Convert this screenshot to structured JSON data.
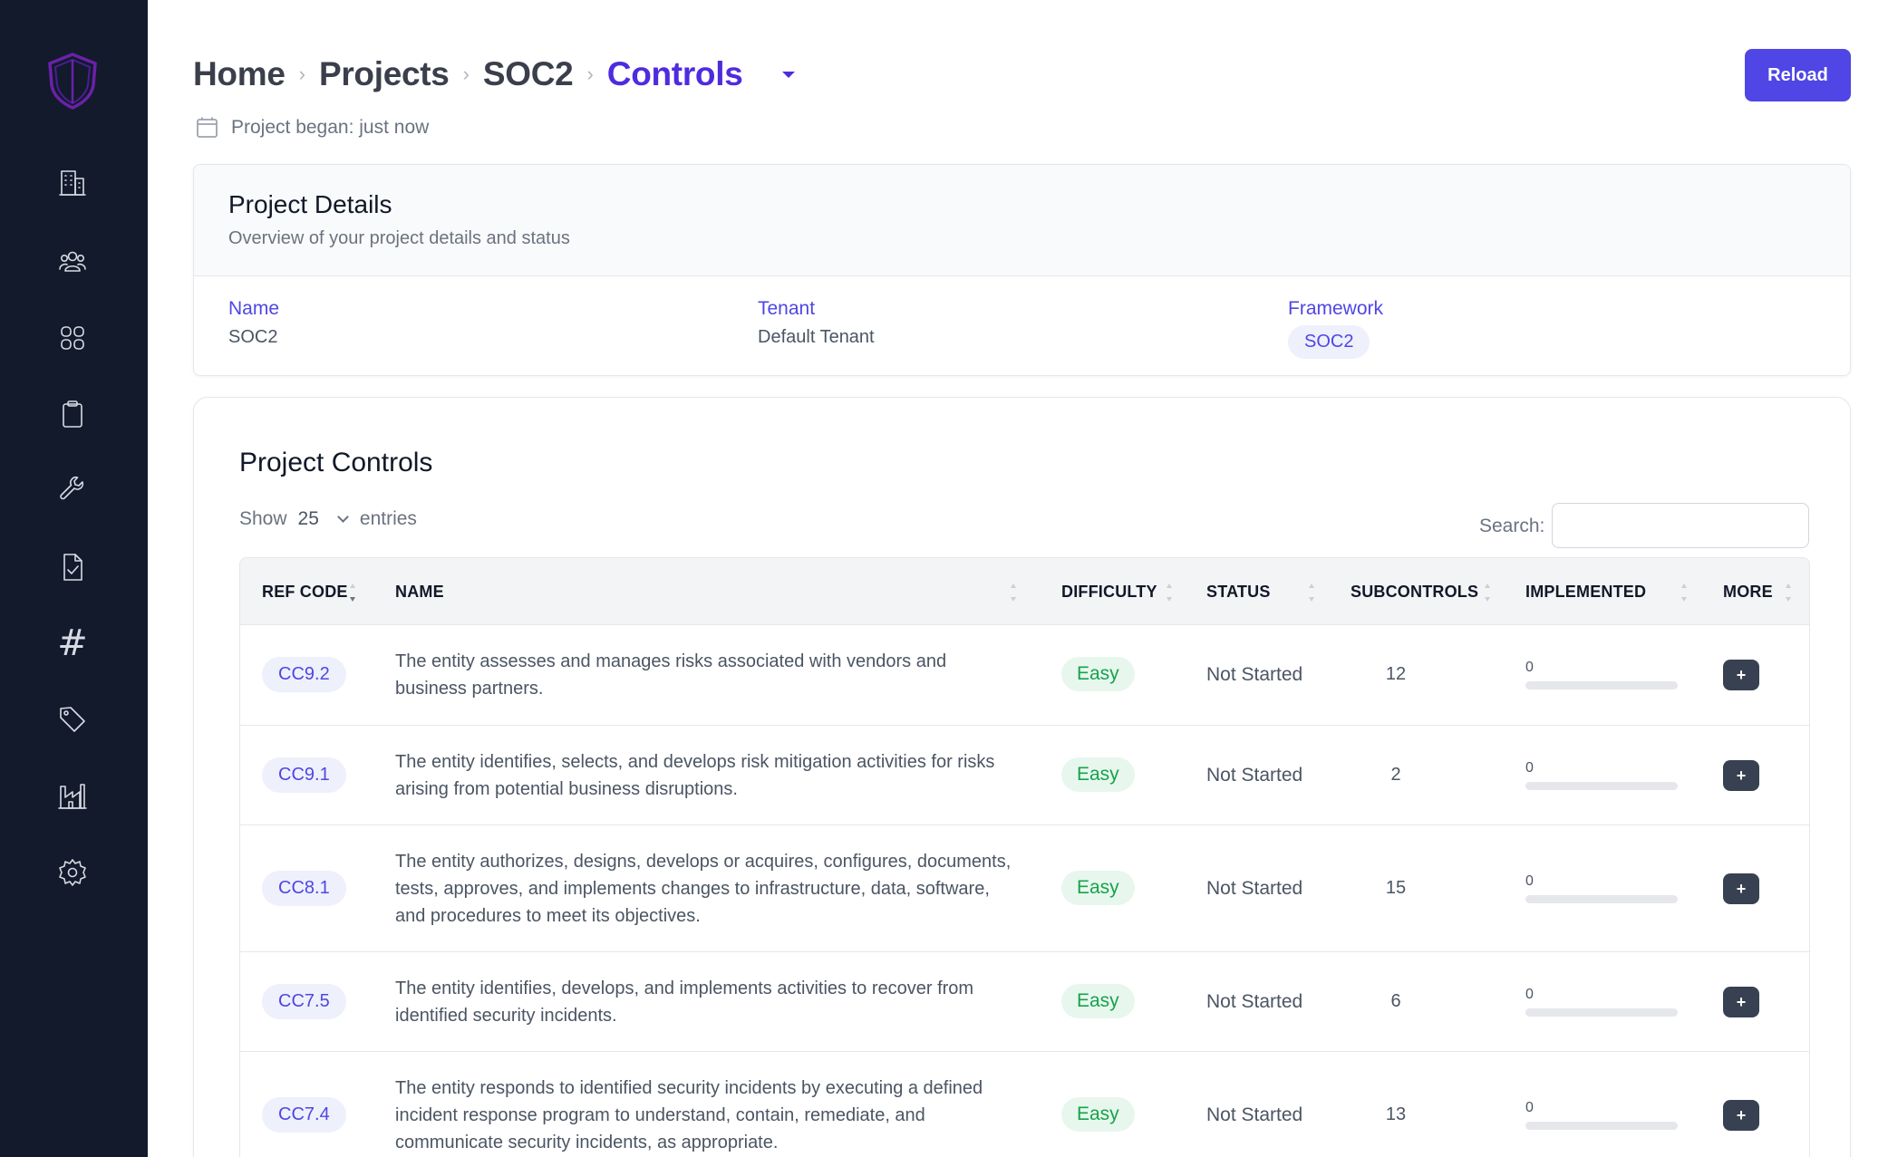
{
  "breadcrumb": {
    "items": [
      "Home",
      "Projects",
      "SOC2"
    ],
    "current": "Controls"
  },
  "began": "Project began: just now",
  "reload_label": "Reload",
  "details": {
    "title": "Project Details",
    "subtitle": "Overview of your project details and status",
    "name_label": "Name",
    "name_value": "SOC2",
    "tenant_label": "Tenant",
    "tenant_value": "Default Tenant",
    "framework_label": "Framework",
    "framework_value": "SOC2"
  },
  "controls": {
    "title": "Project Controls",
    "show_label": "Show",
    "page_size": "25",
    "entries_label": "entries",
    "search_label": "Search:",
    "search_value": "",
    "columns": {
      "ref": "REF CODE",
      "name": "NAME",
      "difficulty": "DIFFICULTY",
      "status": "STATUS",
      "subcontrols": "SUBCONTROLS",
      "implemented": "IMPLEMENTED",
      "more": "MORE"
    },
    "more_label": "+",
    "rows": [
      {
        "ref": "CC9.2",
        "name": "The entity assesses and manages risks associated with vendors and business partners.",
        "difficulty": "Easy",
        "status": "Not Started",
        "subcontrols": "12",
        "implemented": "0",
        "implemented_fraction": 0
      },
      {
        "ref": "CC9.1",
        "name": "The entity identifies, selects, and develops risk mitigation activities for risks arising from potential business disruptions.",
        "difficulty": "Easy",
        "status": "Not Started",
        "subcontrols": "2",
        "implemented": "0",
        "implemented_fraction": 0
      },
      {
        "ref": "CC8.1",
        "name": "The entity authorizes, designs, develops or acquires, configures, documents, tests, approves, and implements changes to infrastructure, data, software, and procedures to meet its objectives.",
        "difficulty": "Easy",
        "status": "Not Started",
        "subcontrols": "15",
        "implemented": "0",
        "implemented_fraction": 0
      },
      {
        "ref": "CC7.5",
        "name": "The entity identifies, develops, and implements activities to recover from identified security incidents.",
        "difficulty": "Easy",
        "status": "Not Started",
        "subcontrols": "6",
        "implemented": "0",
        "implemented_fraction": 0
      },
      {
        "ref": "CC7.4",
        "name": "The entity responds to identified security incidents by executing a defined incident response program to understand, contain, remediate, and communicate security incidents, as appropriate.",
        "difficulty": "Easy",
        "status": "Not Started",
        "subcontrols": "13",
        "implemented": "0",
        "implemented_fraction": 0
      }
    ]
  },
  "sidebar": {
    "icons": [
      "building-icon",
      "users-icon",
      "grid-icon",
      "clipboard-icon",
      "wrench-icon",
      "document-check-icon",
      "hashtag-icon",
      "tag-icon",
      "factory-icon",
      "gear-icon"
    ]
  },
  "colors": {
    "sidebar_bg": "#121a2c",
    "accent": "#4f46e5",
    "breadcrumb_current": "#4f2bdf",
    "difficulty_easy": "#16a34a"
  }
}
